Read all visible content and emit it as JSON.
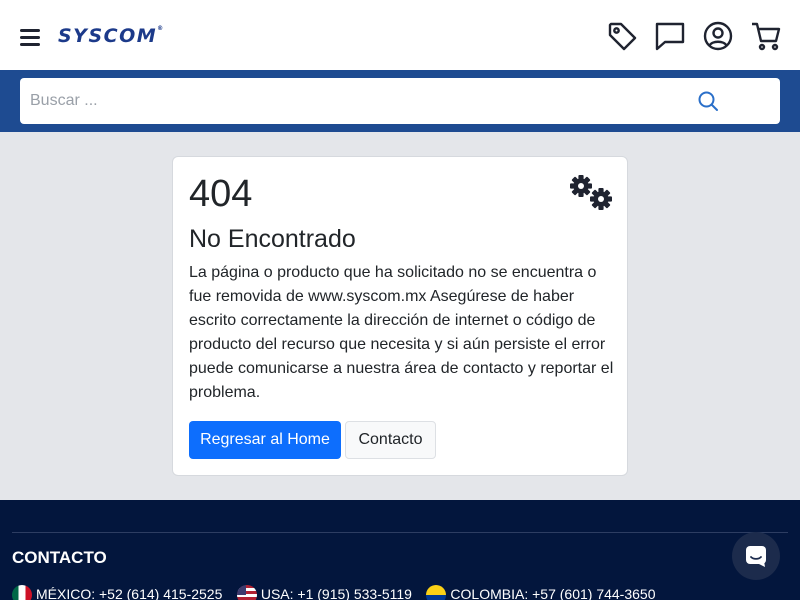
{
  "header": {
    "logo_text": "SYSCOM",
    "logo_mark": "®",
    "icons": [
      "menu-icon",
      "tag-icon",
      "chat-icon",
      "user-icon",
      "cart-icon"
    ]
  },
  "search": {
    "placeholder": "Buscar ...",
    "icon": "search-icon"
  },
  "error": {
    "code": "404",
    "title": "No Encontrado",
    "message": "La página o producto que ha solicitado no se encuentra o fue removida de www.syscom.mx Asegúrese de haber escrito correctamente la dirección de internet o código de producto del recurso que necesita y si aún persiste el error puede comunicarse a nuestra área de contacto y reportar el problema.",
    "home_button": "Regresar al Home",
    "contact_button": "Contacto"
  },
  "footer": {
    "title": "CONTACTO",
    "phones": [
      {
        "label": "MÉXICO: +52 (614) 415-2525",
        "flag": "mx"
      },
      {
        "label": "USA: +1 (915) 533-5119",
        "flag": "us"
      },
      {
        "label": "COLOMBIA: +57 (601) 744-3650",
        "flag": "co"
      }
    ]
  },
  "colors": {
    "brand_blue": "#1e4b91",
    "footer_navy": "#03163d",
    "primary_button": "#0d6efd",
    "page_background": "#e4e6ea"
  }
}
